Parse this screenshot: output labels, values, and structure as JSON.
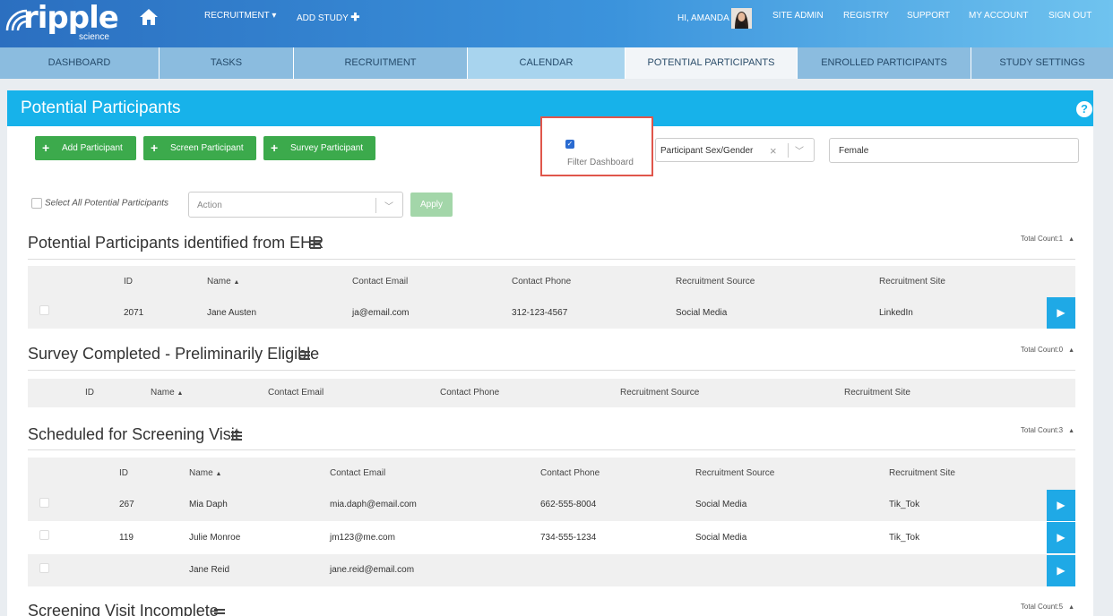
{
  "brand": {
    "name": "ripple",
    "sub": "science"
  },
  "topnav": {
    "recruitment": "RECRUITMENT",
    "add_study": "ADD STUDY",
    "greeting": "HI, AMANDA",
    "site_admin": "SITE ADMIN",
    "registry": "REGISTRY",
    "support": "SUPPORT",
    "my_account": "MY ACCOUNT",
    "sign_out": "SIGN OUT"
  },
  "tabs": [
    "DASHBOARD",
    "TASKS",
    "RECRUITMENT",
    "CALENDAR",
    "POTENTIAL PARTICIPANTS",
    "ENROLLED PARTICIPANTS",
    "STUDY SETTINGS"
  ],
  "active_tab": "POTENTIAL PARTICIPANTS",
  "page": {
    "title": "Potential Participants",
    "help": "?"
  },
  "buttons": {
    "add": "Add Participant",
    "screen": "Screen Participant",
    "survey": "Survey Participant",
    "apply": "Apply"
  },
  "filter": {
    "label": "Filter Dashboard",
    "checked": true,
    "field": "Participant Sex/Gender",
    "value": "Female"
  },
  "bulk": {
    "select_all": "Select All Potential Participants",
    "action_placeholder": "Action"
  },
  "sections": [
    {
      "title": "Potential Participants identified from EHR",
      "total": "Total Count:1",
      "cols": [
        "ID",
        "Name",
        "Contact Email",
        "Contact Phone",
        "Recruitment Source",
        "Recruitment Site"
      ],
      "rows": [
        [
          "2071",
          "Jane Austen",
          "ja@email.com",
          "312-123-4567",
          "Social Media",
          "LinkedIn"
        ]
      ]
    },
    {
      "title": "Survey Completed - Preliminarily Eligible",
      "total": "Total Count:0",
      "cols": [
        "ID",
        "Name",
        "Contact Email",
        "Contact Phone",
        "Recruitment Source",
        "Recruitment Site"
      ],
      "rows": []
    },
    {
      "title": "Scheduled for Screening Visit",
      "total": "Total Count:3",
      "cols": [
        "ID",
        "Name",
        "Contact Email",
        "Contact Phone",
        "Recruitment Source",
        "Recruitment Site"
      ],
      "rows": [
        [
          "267",
          "Mia Daph",
          "mia.daph@email.com",
          "662-555-8004",
          "Social Media",
          "Tik_Tok"
        ],
        [
          "119",
          "Julie Monroe",
          "jm123@me.com",
          "734-555-1234",
          "Social Media",
          "Tik_Tok"
        ],
        [
          "",
          "Jane Reid",
          "jane.reid@email.com",
          "",
          "",
          ""
        ]
      ]
    },
    {
      "title": "Screening Visit Incomplete",
      "total": "Total Count:5",
      "cols": [],
      "rows": []
    }
  ],
  "icons": {
    "home": "home-icon",
    "list": "list-icon",
    "go": "chevron-right-icon",
    "sort": "sort-up-icon"
  }
}
